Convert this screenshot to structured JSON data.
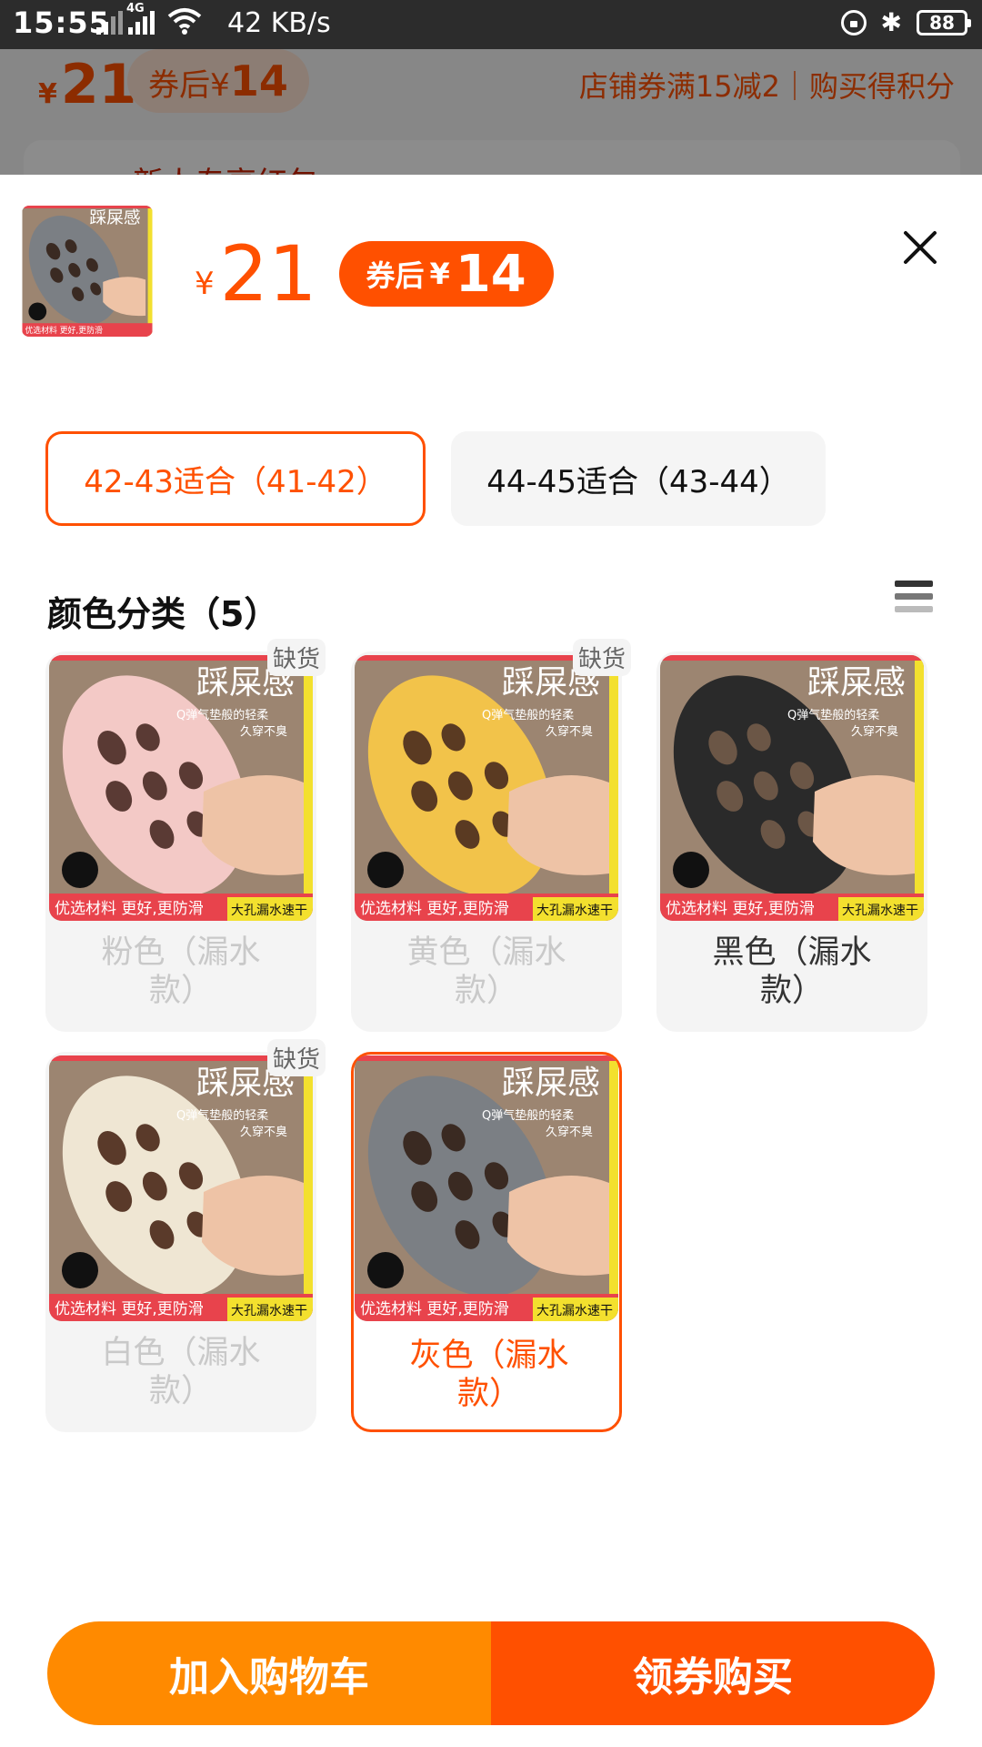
{
  "status_bar": {
    "time": "15:55",
    "network_type": "4G",
    "speed": "42 KB/s",
    "battery": "88"
  },
  "background_page": {
    "price_symbol": "¥",
    "price": "21",
    "coupon_label": "券后",
    "coupon_symbol": "¥",
    "coupon_price": "14",
    "promo_text": "店铺券满15减2｜购买得积分",
    "banner_text": "新人专享红包"
  },
  "sheet": {
    "price_symbol": "¥",
    "price": "21",
    "coupon_label": "券后",
    "coupon_symbol": "¥",
    "coupon_price": "14",
    "thumbnail_text": {
      "title": "踩屎感",
      "footer": "优选材料 更好,更防滑",
      "tag": "大孔漏水速干"
    }
  },
  "sizes": [
    {
      "label": "42-43适合（41-42）",
      "selected": true
    },
    {
      "label": "44-45适合（43-44）",
      "selected": false
    }
  ],
  "color_section": {
    "title": "颜色分类（5）",
    "out_of_stock_label": "缺货",
    "image_text": {
      "title": "踩屎感",
      "subtitle_1": "Q弹气垫般的轻柔",
      "subtitle_2": "久穿不臭",
      "footer": "优选材料 更好,更防滑",
      "tag": "大孔漏水速干"
    },
    "options": [
      {
        "name": "粉色（漏水款）",
        "color": "#f3c9c6",
        "out_of_stock": true,
        "selected": false
      },
      {
        "name": "黄色（漏水款）",
        "color": "#f2c34a",
        "out_of_stock": true,
        "selected": false
      },
      {
        "name": "黑色（漏水款）",
        "color": "#2a2a2a",
        "out_of_stock": false,
        "selected": false
      },
      {
        "name": "白色（漏水款）",
        "color": "#efe6d3",
        "out_of_stock": true,
        "selected": false
      },
      {
        "name": "灰色（漏水款）",
        "color": "#7b7f84",
        "out_of_stock": false,
        "selected": true
      }
    ]
  },
  "actions": {
    "add_to_cart": "加入购物车",
    "buy_with_coupon": "领券购买"
  },
  "colors": {
    "accent": "#ff5000",
    "accent_secondary": "#ff8a00",
    "image_background": "#9c8571"
  }
}
